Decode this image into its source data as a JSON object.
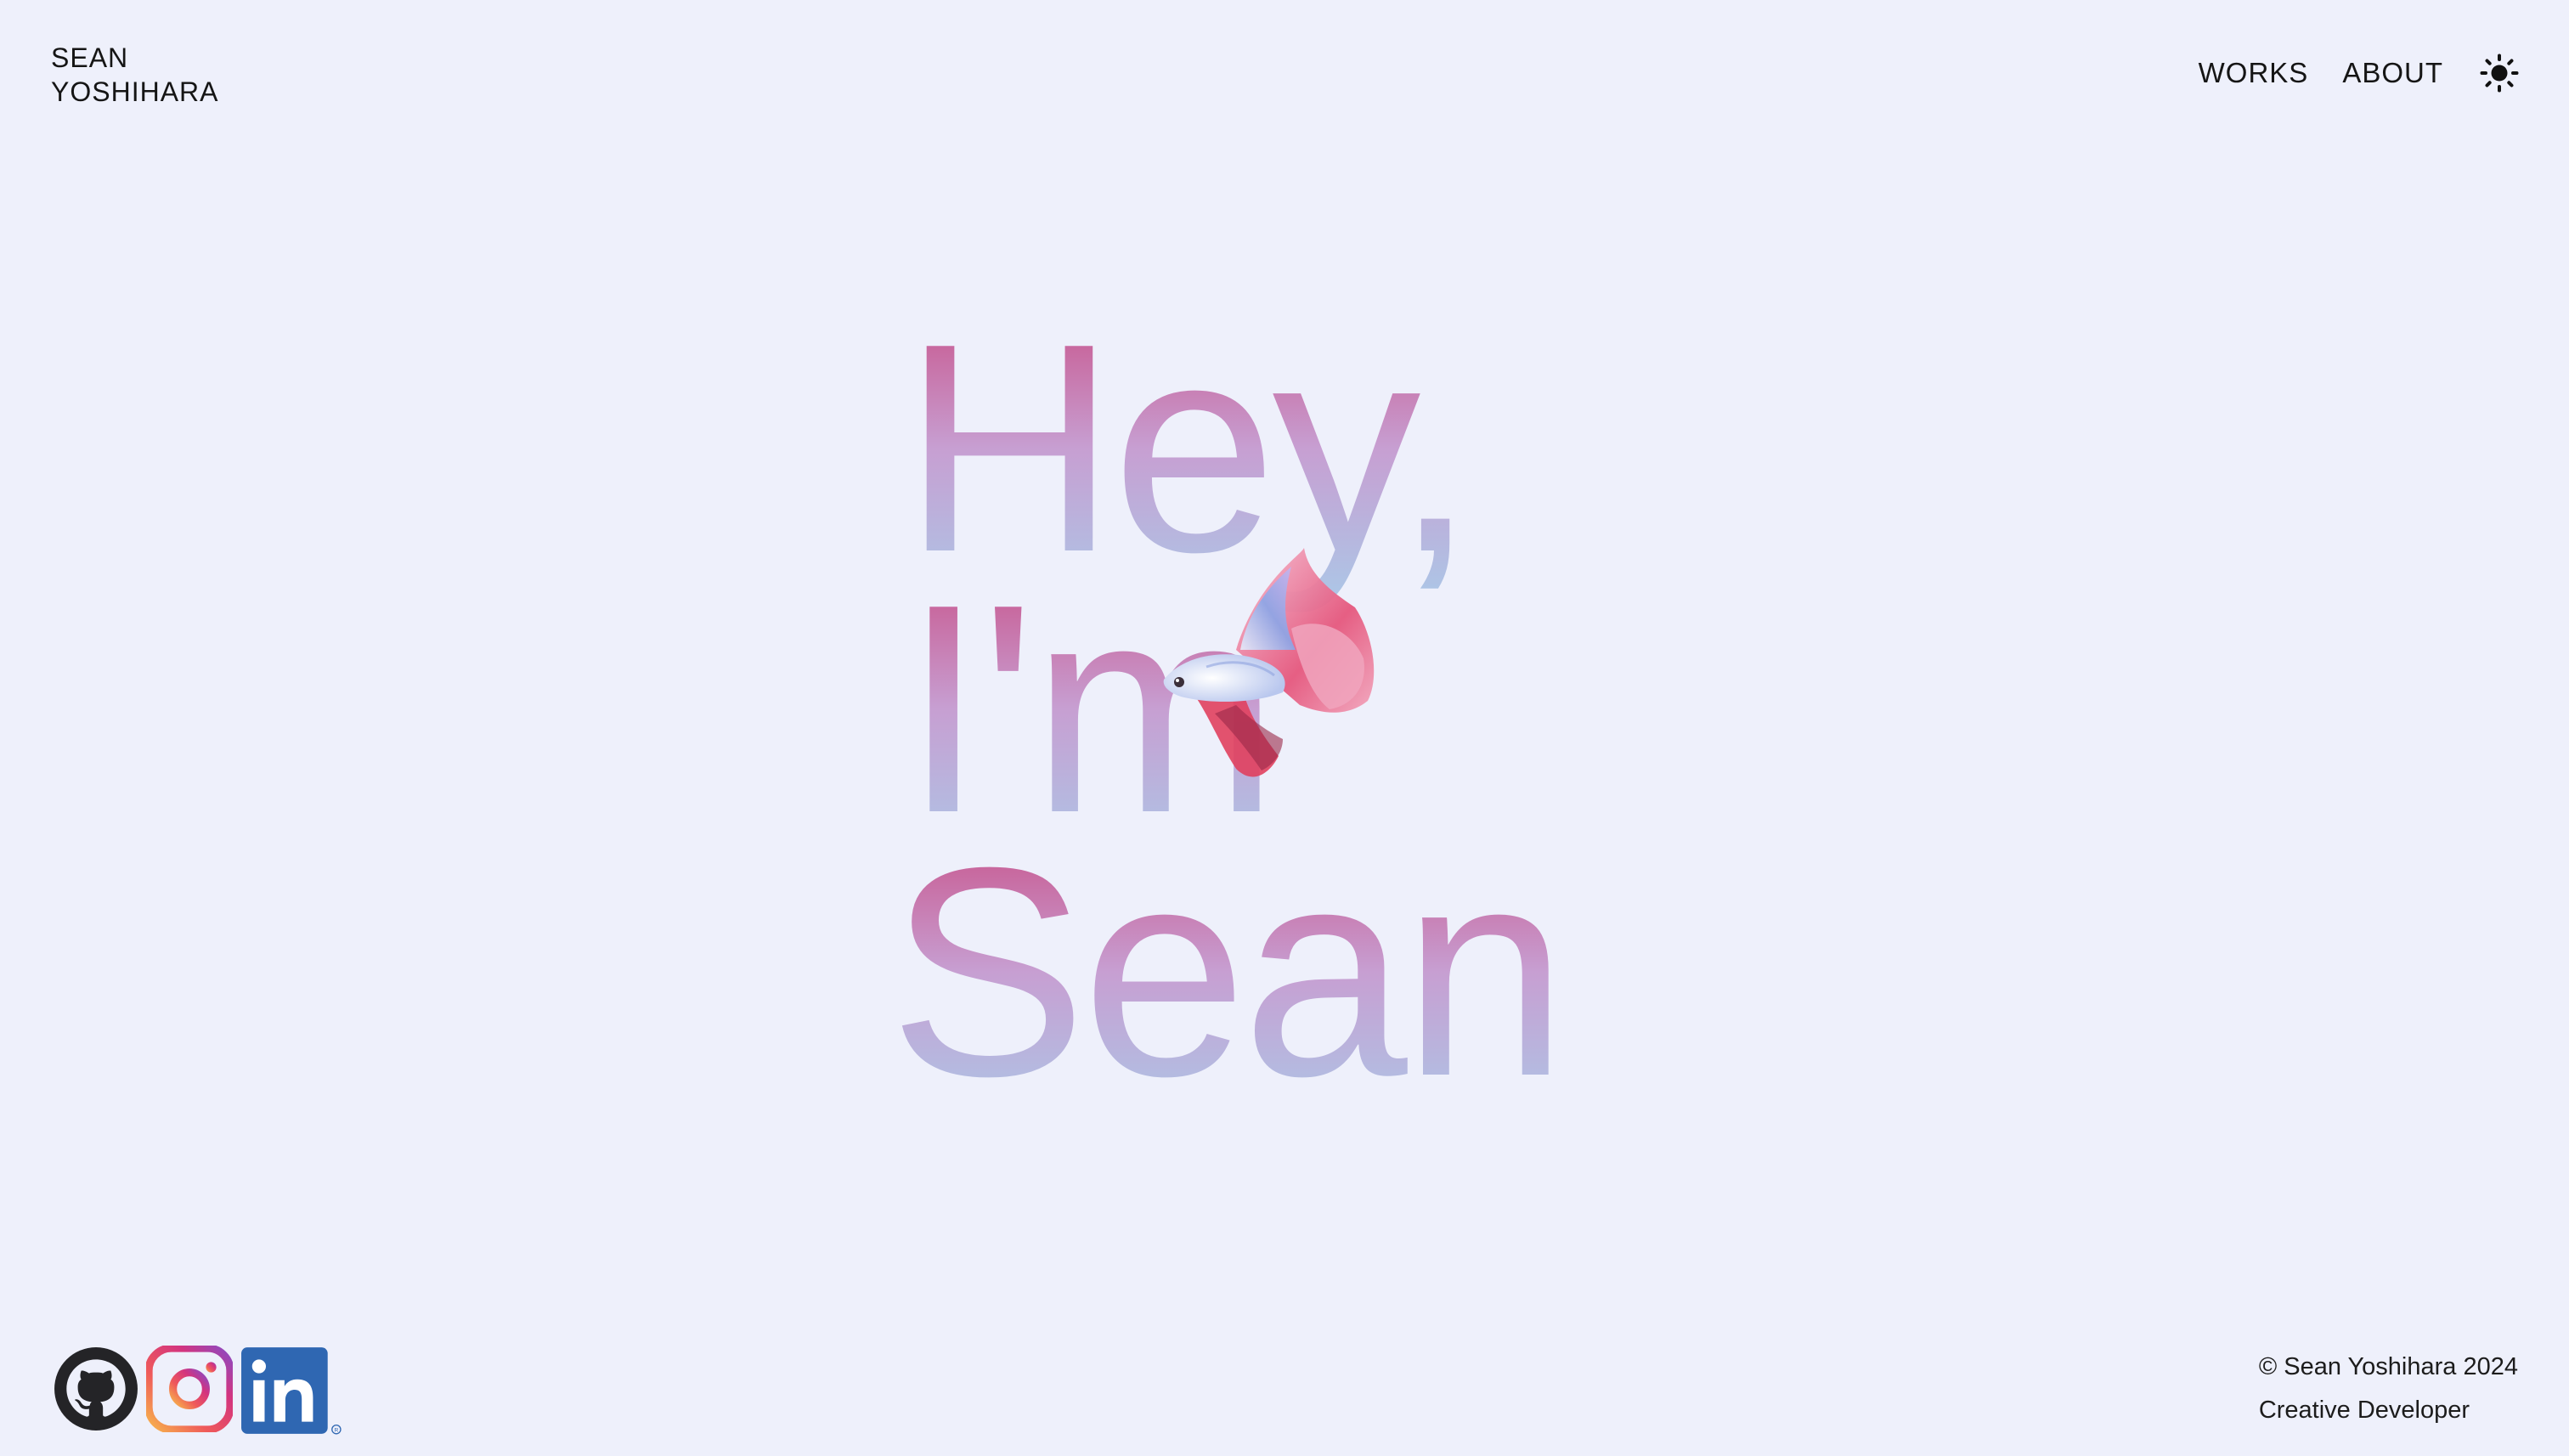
{
  "header": {
    "brand_line1": "SEAN",
    "brand_line2": "YOSHIHARA",
    "nav": [
      {
        "label": "WORKS"
      },
      {
        "label": "ABOUT"
      }
    ],
    "theme_icon": "sun-icon"
  },
  "hero": {
    "line1": "Hey,",
    "line2": "I'm",
    "line3": "Sean",
    "gradient_colors": [
      "#c9477f",
      "#c79fd2",
      "#a9cbe9"
    ],
    "image": "betta-fish"
  },
  "footer": {
    "social": [
      {
        "icon": "github-icon"
      },
      {
        "icon": "instagram-icon"
      },
      {
        "icon": "linkedin-icon"
      }
    ],
    "copyright": "© Sean Yoshihara 2024",
    "role": "Creative Developer"
  }
}
